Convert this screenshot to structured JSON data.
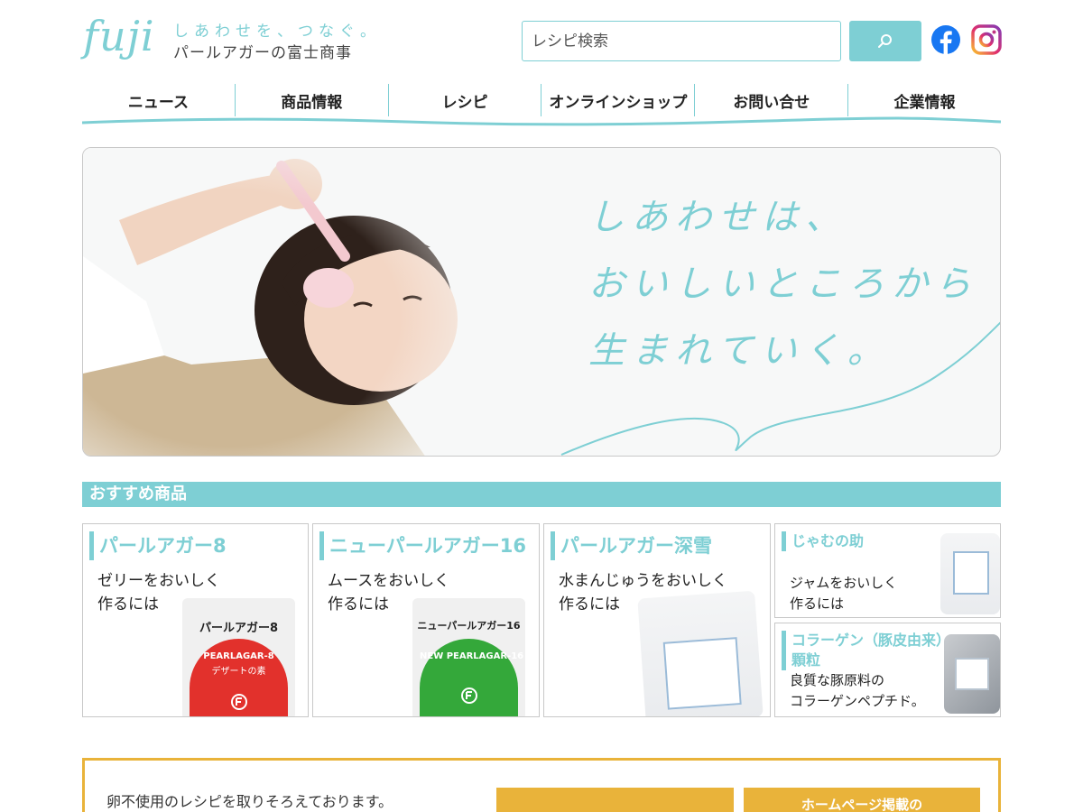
{
  "header": {
    "logo_text": "fuji",
    "tagline": "しあわせを、つなぐ。",
    "company": "パールアガーの富士商事",
    "search": {
      "placeholder": "レシピ検索",
      "icon": "search-icon"
    },
    "social": [
      {
        "name": "facebook-icon",
        "color": "#1877f2"
      },
      {
        "name": "instagram-icon",
        "color": "#e1306c"
      }
    ]
  },
  "nav": {
    "items": [
      "ニュース",
      "商品情報",
      "レシピ",
      "オンラインショップ",
      "お問い合せ",
      "企業情報"
    ]
  },
  "hero": {
    "copy_lines": [
      "しあわせは、",
      "おいしいところから",
      "生まれていく。"
    ]
  },
  "recommended": {
    "heading": "おすすめ商品",
    "products": [
      {
        "title": "パールアガー8",
        "desc_line1": "ゼリーをおいしく",
        "desc_line2": "作るには",
        "package_label": "パールアガー8",
        "package_brand": "PEARLAGAR-8",
        "package_sub": "デザートの素",
        "package_color": "#e2312c"
      },
      {
        "title": "ニューパールアガー16",
        "desc_line1": "ムースをおいしく",
        "desc_line2": "作るには",
        "package_label": "ニューパールアガー16",
        "package_brand": "NEW PEARLAGAR-16",
        "package_color": "#34a83a"
      },
      {
        "title": "パールアガー深雪",
        "desc_line1": "水まんじゅうをおいしく",
        "desc_line2": "作るには"
      },
      {
        "title": "じゃむの助",
        "desc_line1": "ジャムをおいしく",
        "desc_line2": "作るには"
      },
      {
        "title_line1": "コラーゲン（豚皮由来）",
        "title_line2": "顆粒",
        "desc_line1": "良質な豚原料の",
        "desc_line2": "コラーゲンペプチド。"
      }
    ]
  },
  "banner": {
    "text": "卵不使用のレシピを取りそろえております。",
    "button2_label": "ホームページ掲載の"
  },
  "colors": {
    "accent": "#7ecfd4",
    "banner": "#e9b33a"
  }
}
